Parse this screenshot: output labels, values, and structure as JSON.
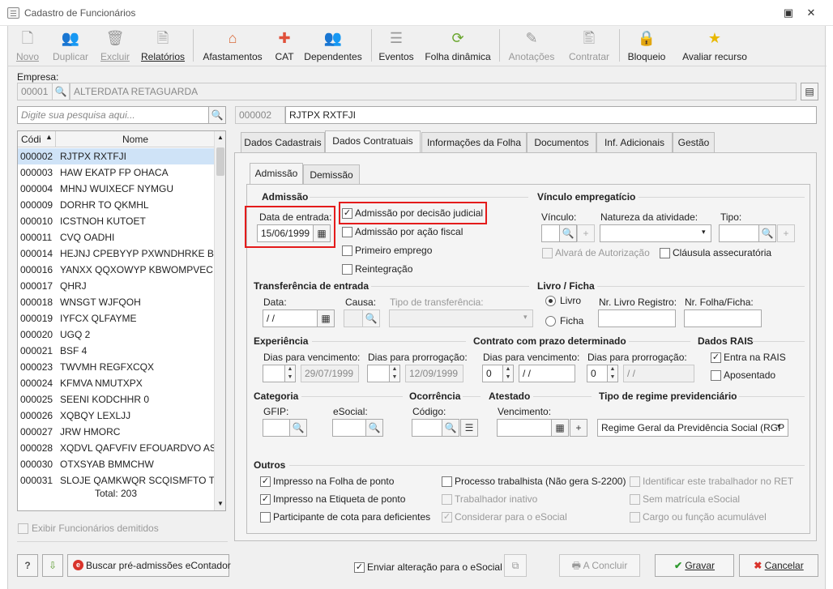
{
  "window": {
    "title": "Cadastro de Funcionários"
  },
  "toolbar": {
    "novo": "Novo",
    "duplicar": "Duplicar",
    "excluir": "Excluir",
    "relatorios": "Relatórios",
    "afastamentos": "Afastamentos",
    "cat": "CAT",
    "dependentes": "Dependentes",
    "eventos": "Eventos",
    "folha_dinamica": "Folha dinâmica",
    "anotacoes": "Anotações",
    "contratar": "Contratar",
    "bloqueio": "Bloqueio",
    "avaliar_recurso": "Avaliar recurso"
  },
  "empresa": {
    "label": "Empresa:",
    "code": "00001",
    "name": "ALTERDATA RETAGUARDA"
  },
  "search": {
    "placeholder": "Digite sua pesquisa aqui..."
  },
  "employee": {
    "code": "000002",
    "name": "RJTPX RXTFJI"
  },
  "grid": {
    "col_code": "Códi",
    "col_name": "Nome",
    "rows": [
      {
        "code": "000002",
        "name": "RJTPX RXTFJI"
      },
      {
        "code": "000003",
        "name": "HAW EKATP FP OHACA"
      },
      {
        "code": "000004",
        "name": "MHNJ WUIXECF NYMGU"
      },
      {
        "code": "000009",
        "name": "DORHR TO QKMHL"
      },
      {
        "code": "000010",
        "name": "ICSTNOH KUTOET"
      },
      {
        "code": "000011",
        "name": "CVQ OADHI"
      },
      {
        "code": "000014",
        "name": "HEJNJ CPEBYYP PXWNDHRKE BTB J"
      },
      {
        "code": "000016",
        "name": "YANXX QQXOWYP KBWOMPVEC A"
      },
      {
        "code": "000017",
        "name": "QHRJ"
      },
      {
        "code": "000018",
        "name": "WNSGT WJFQOH"
      },
      {
        "code": "000019",
        "name": "IYFCX QLFAYME"
      },
      {
        "code": "000020",
        "name": "UGQ 2"
      },
      {
        "code": "000021",
        "name": "BSF 4"
      },
      {
        "code": "000023",
        "name": "TWVMH REGFXCQX"
      },
      {
        "code": "000024",
        "name": "KFMVA NMUTXPX"
      },
      {
        "code": "000025",
        "name": "SEENI KODCHHR 0"
      },
      {
        "code": "000026",
        "name": "XQBQY LEXLJJ"
      },
      {
        "code": "000027",
        "name": "JRW HMORC"
      },
      {
        "code": "000028",
        "name": "XQDVL QAFVFIV EFOUARDVO AST L"
      },
      {
        "code": "000030",
        "name": "OTXSYAB BMMCHW"
      },
      {
        "code": "000031",
        "name": "SLOJE QAMKWQR SCQISMFTO TDP"
      }
    ],
    "total": "Total: 203"
  },
  "exibir_demitidos": "Exibir Funcionários demitidos",
  "tabs": [
    "Dados Cadastrais",
    "Dados Contratuais",
    "Informações da Folha",
    "Documentos",
    "Inf. Adicionais",
    "Gestão"
  ],
  "subtabs": [
    "Admissão",
    "Demissão"
  ],
  "admissao": {
    "title": "Admissão",
    "data_entrada_label": "Data de entrada:",
    "data_entrada": "15/06/1999",
    "decisao_judicial": "Admissão por decisão judicial",
    "acao_fiscal": "Admissão por ação fiscal",
    "primeiro_emprego": "Primeiro emprego",
    "reintegracao": "Reintegração"
  },
  "vinculo": {
    "title": "Vínculo empregatício",
    "vinculo_label": "Vínculo:",
    "natureza_label": "Natureza da atividade:",
    "tipo_label": "Tipo:",
    "alvara": "Alvará de Autorização",
    "clausula": "Cláusula assecuratória"
  },
  "transferencia": {
    "title": "Transferência de entrada",
    "data_label": "Data:",
    "data_value": " /  /",
    "causa_label": "Causa:",
    "tipo_label": "Tipo de transferência:"
  },
  "livro": {
    "title": "Livro / Ficha",
    "livro": "Livro",
    "ficha": "Ficha",
    "nr_livro_label": "Nr. Livro Registro:",
    "nr_folha_label": "Nr. Folha/Ficha:"
  },
  "experiencia": {
    "title": "Experiência",
    "dias_venc_label": "Dias para vencimento:",
    "dias_prorr_label": "Dias para prorrogação:",
    "venc_date": "29/07/1999",
    "prorr_date": "12/09/1999"
  },
  "contrato": {
    "title": "Contrato com prazo determinado",
    "dias_venc_label": "Dias para vencimento:",
    "dias_prorr_label": "Dias para prorrogação:",
    "venc_days": "0",
    "venc_date": " /  /",
    "prorr_days": "0",
    "prorr_date": " /  /"
  },
  "rais": {
    "title": "Dados RAIS",
    "entra": "Entra na RAIS",
    "aposentado": "Aposentado"
  },
  "categoria": {
    "title": "Categoria",
    "gfip_label": "GFIP:",
    "esocial_label": "eSocial:"
  },
  "ocorrencia": {
    "title": "Ocorrência",
    "codigo_label": "Código:"
  },
  "atestado": {
    "title": "Atestado",
    "vencimento_label": "Vencimento:"
  },
  "regime": {
    "title": "Tipo de regime previdenciário",
    "value": "Regime Geral da Previdência Social (RGP"
  },
  "outros": {
    "title": "Outros",
    "folha_ponto": "Impresso na Folha de ponto",
    "etiqueta_ponto": "Impresso na Etiqueta de ponto",
    "cota_deficientes": "Participante de cota para deficientes",
    "processo_trabalhista": "Processo trabalhista (Não gera S-2200)",
    "trabalhador_inativo": "Trabalhador inativo",
    "considerar_esocial": "Considerar para o eSocial",
    "identificar_ret": "Identificar este trabalhador no RET",
    "sem_matricula": "Sem matrícula eSocial",
    "cargo_acumulavel": "Cargo ou função acumulável"
  },
  "footer": {
    "help": "?",
    "buscar": "Buscar pré-admissões eContador",
    "enviar_esocial": "Enviar alteração para o eSocial",
    "concluir": "A Concluir",
    "gravar": "Gravar",
    "cancelar": "Cancelar"
  },
  "colors": {
    "accent_red": "#e41b1b",
    "selection": "#cfe3f7",
    "green_check": "#2e9a2e",
    "cancel_red": "#d9332b"
  }
}
